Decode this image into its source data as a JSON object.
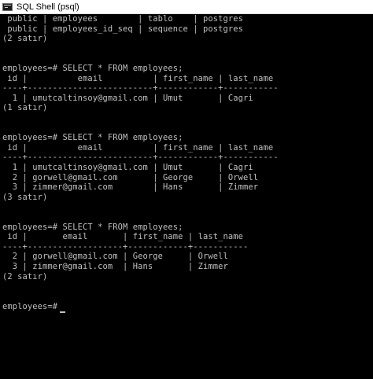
{
  "window": {
    "title": "SQL Shell (psql)"
  },
  "console": {
    "lines": [
      " public | employees        | tablo    | postgres",
      " public | employees_id_seq | sequence | postgres",
      "(2 satır)",
      "",
      "",
      "employees=# SELECT * FROM employees;",
      " id |          email          | first_name | last_name",
      "----+-------------------------+------------+-----------",
      "  1 | umutcaltinsoy@gmail.com | Umut       | Cagri",
      "(1 satır)",
      "",
      "",
      "employees=# SELECT * FROM employees;",
      " id |          email          | first_name | last_name",
      "----+-------------------------+------------+-----------",
      "  1 | umutcaltinsoy@gmail.com | Umut       | Cagri",
      "  2 | gorwell@gmail.com       | George     | Orwell",
      "  3 | zimmer@gmail.com        | Hans       | Zimmer",
      "(3 satır)",
      "",
      "",
      "employees=# SELECT * FROM employees;",
      " id |       email       | first_name | last_name",
      "----+-------------------+------------+-----------",
      "  2 | gorwell@gmail.com | George     | Orwell",
      "  3 | zimmer@gmail.com  | Hans       | Zimmer",
      "(2 satır)",
      "",
      "",
      "",
      "employees=# "
    ]
  }
}
